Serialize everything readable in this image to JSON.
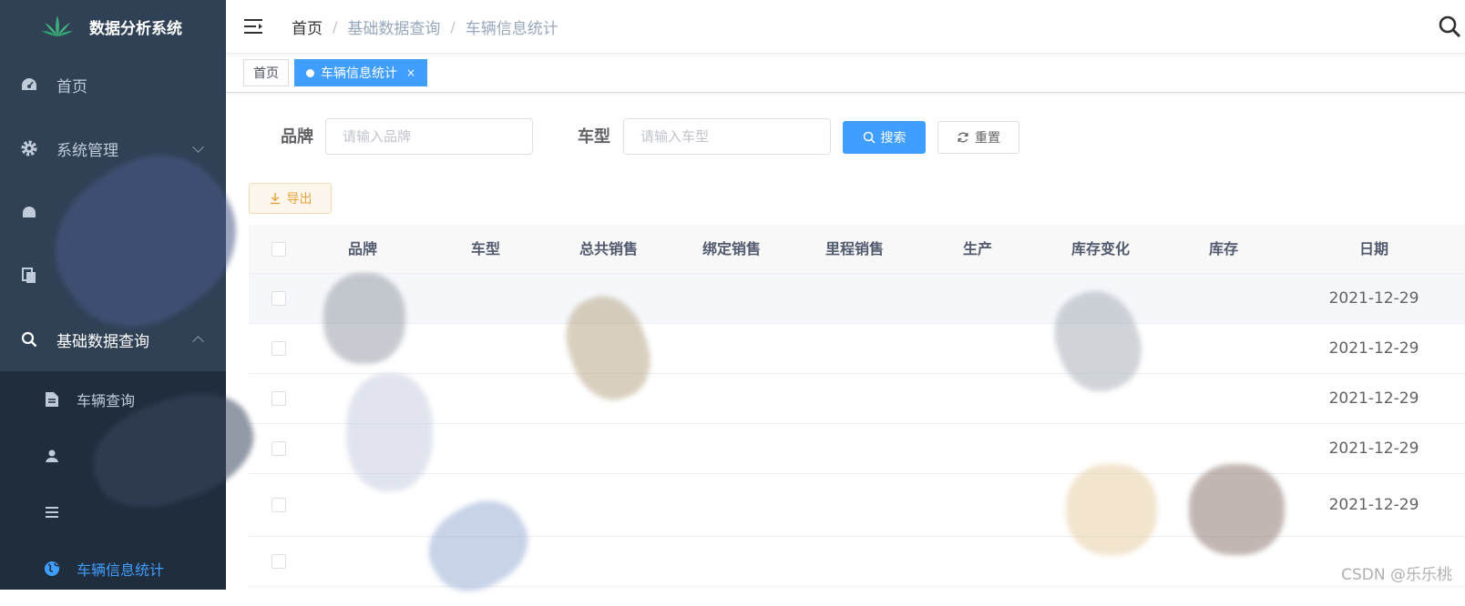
{
  "app": {
    "title": "数据分析系统"
  },
  "sidebar": {
    "items": [
      {
        "label": "首页",
        "icon": "dashboard-icon"
      },
      {
        "label": "系统管理",
        "icon": "gear-icon",
        "expandable": true,
        "expanded": false
      },
      {
        "label": "",
        "icon": "monitor-icon"
      },
      {
        "label": "",
        "icon": "document-icon"
      },
      {
        "label": "基础数据查询",
        "icon": "search-icon",
        "expandable": true,
        "expanded": true
      }
    ],
    "subitems": [
      {
        "label": "车辆查询",
        "icon": "file-icon"
      },
      {
        "label": "",
        "icon": "user-icon"
      },
      {
        "label": "",
        "icon": "list-icon"
      },
      {
        "label": "车辆信息统计",
        "icon": "globe-icon",
        "active": true
      }
    ]
  },
  "breadcrumb": [
    "首页",
    "基础数据查询",
    "车辆信息统计"
  ],
  "tags": [
    {
      "label": "首页",
      "active": false
    },
    {
      "label": "车辆信息统计",
      "active": true,
      "close": "×"
    }
  ],
  "search": {
    "brand_label": "品牌",
    "brand_placeholder": "请输入品牌",
    "model_label": "车型",
    "model_placeholder": "请输入车型",
    "search_button": "搜索",
    "reset_button": "重置"
  },
  "export_button": "导出",
  "table": {
    "columns": [
      "品牌",
      "车型",
      "总共销售",
      "绑定销售",
      "里程销售",
      "生产",
      "库存变化",
      "库存",
      "日期"
    ],
    "rows": [
      {
        "date": "2021-12-29"
      },
      {
        "date": "2021-12-29"
      },
      {
        "date": "2021-12-29"
      },
      {
        "date": "2021-12-29"
      },
      {
        "date": "2021-12-29"
      },
      {
        "date": ""
      }
    ]
  },
  "watermark": "CSDN @乐乐桃",
  "colors": {
    "primary": "#409eff",
    "sidebar": "#304156",
    "submenu": "#1f2d3d",
    "warning": "#e6a23c"
  }
}
